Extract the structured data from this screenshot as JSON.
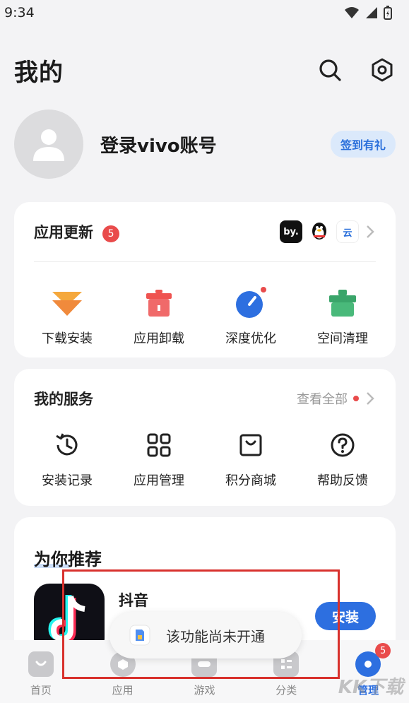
{
  "status_bar": {
    "time": "9:34"
  },
  "header": {
    "title": "我的"
  },
  "profile": {
    "login_text": "登录vivo账号",
    "checkin_label": "签到有礼"
  },
  "updates": {
    "title": "应用更新",
    "count": "5",
    "apps": [
      {
        "label": "by."
      },
      {
        "label": "QQ"
      },
      {
        "label": "云"
      }
    ],
    "tools": [
      {
        "label": "下载安装",
        "icon": "download-icon",
        "color": "#f08a3c"
      },
      {
        "label": "应用卸载",
        "icon": "uninstall-icon",
        "color": "#ef5350"
      },
      {
        "label": "深度优化",
        "icon": "optimize-icon",
        "color": "#2d6fe0"
      },
      {
        "label": "空间清理",
        "icon": "clean-icon",
        "color": "#3aa56a"
      }
    ]
  },
  "services": {
    "title": "我的服务",
    "see_all": "查看全部",
    "items": [
      {
        "label": "安装记录",
        "icon": "history-icon"
      },
      {
        "label": "应用管理",
        "icon": "grid-icon"
      },
      {
        "label": "积分商城",
        "icon": "shop-icon"
      },
      {
        "label": "帮助反馈",
        "icon": "help-icon"
      }
    ]
  },
  "recommend": {
    "title": "为你推荐",
    "app_name": "抖音",
    "install_label": "安装"
  },
  "toast": {
    "text": "该功能尚未开通"
  },
  "bottom_nav": {
    "items": [
      {
        "label": "首页"
      },
      {
        "label": "应用"
      },
      {
        "label": "游戏"
      },
      {
        "label": "分类"
      },
      {
        "label": "管理",
        "badge": "5"
      }
    ]
  },
  "watermark": {
    "text": "KK下载"
  }
}
